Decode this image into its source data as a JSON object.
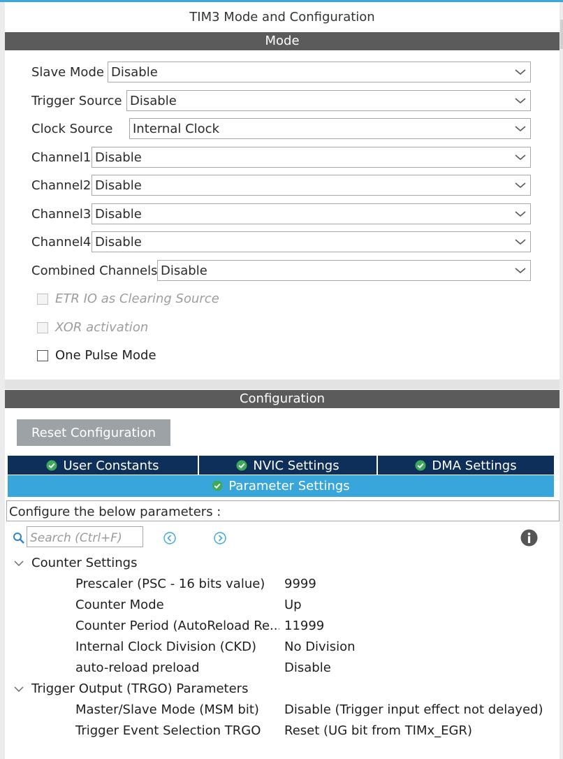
{
  "window": {
    "title": "TIM3 Mode and Configuration"
  },
  "mode": {
    "header": "Mode",
    "fields": [
      {
        "label": "Slave Mode",
        "value": "Disable"
      },
      {
        "label": "Trigger Source",
        "value": "Disable"
      },
      {
        "label": "Clock Source",
        "value": "Internal Clock"
      },
      {
        "label": "Channel1",
        "value": "Disable"
      },
      {
        "label": "Channel2",
        "value": "Disable"
      },
      {
        "label": "Channel3",
        "value": "Disable"
      },
      {
        "label": "Channel4",
        "value": "Disable"
      },
      {
        "label": "Combined Channels",
        "value": "Disable"
      }
    ],
    "checkboxes": [
      {
        "label": "ETR IO as Clearing Source",
        "checked": false,
        "enabled": false
      },
      {
        "label": "XOR activation",
        "checked": false,
        "enabled": false
      },
      {
        "label": "One Pulse Mode",
        "checked": false,
        "enabled": true
      }
    ]
  },
  "configuration": {
    "header": "Configuration",
    "reset_button": "Reset Configuration",
    "tabs": [
      {
        "label": "User Constants"
      },
      {
        "label": "NVIC Settings"
      },
      {
        "label": "DMA Settings"
      }
    ],
    "active_tab": {
      "label": "Parameter Settings"
    },
    "info_text": "Configure the below parameters :",
    "search_placeholder": "Search (Ctrl+F)",
    "groups": [
      {
        "name": "Counter Settings",
        "params": [
          {
            "name": "Prescaler (PSC - 16 bits value)",
            "value": "9999"
          },
          {
            "name": "Counter Mode",
            "value": "Up"
          },
          {
            "name": "Counter Period (AutoReload Re...",
            "value": "11999"
          },
          {
            "name": "Internal Clock Division (CKD)",
            "value": "No Division"
          },
          {
            "name": "auto-reload preload",
            "value": "Disable"
          }
        ]
      },
      {
        "name": "Trigger Output (TRGO) Parameters",
        "params": [
          {
            "name": "Master/Slave Mode (MSM bit)",
            "value": "Disable (Trigger input effect not delayed)"
          },
          {
            "name": "Trigger Event Selection TRGO",
            "value": "Reset (UG bit from TIMx_EGR)"
          }
        ]
      }
    ]
  },
  "colors": {
    "section_header": "#5b5b5b",
    "tab_dark": "#0d2f59",
    "tab_active": "#39a6db",
    "check_green": "#3daa5a",
    "button_gray": "#9da2a6"
  },
  "icons": {
    "dropdown": "chevron-down-icon",
    "tab_status": "check-circle-icon",
    "search": "search-icon",
    "prev": "arrow-left-circle-icon",
    "next": "arrow-right-circle-icon",
    "info": "info-icon",
    "group_toggle": "chevron-down-icon"
  }
}
